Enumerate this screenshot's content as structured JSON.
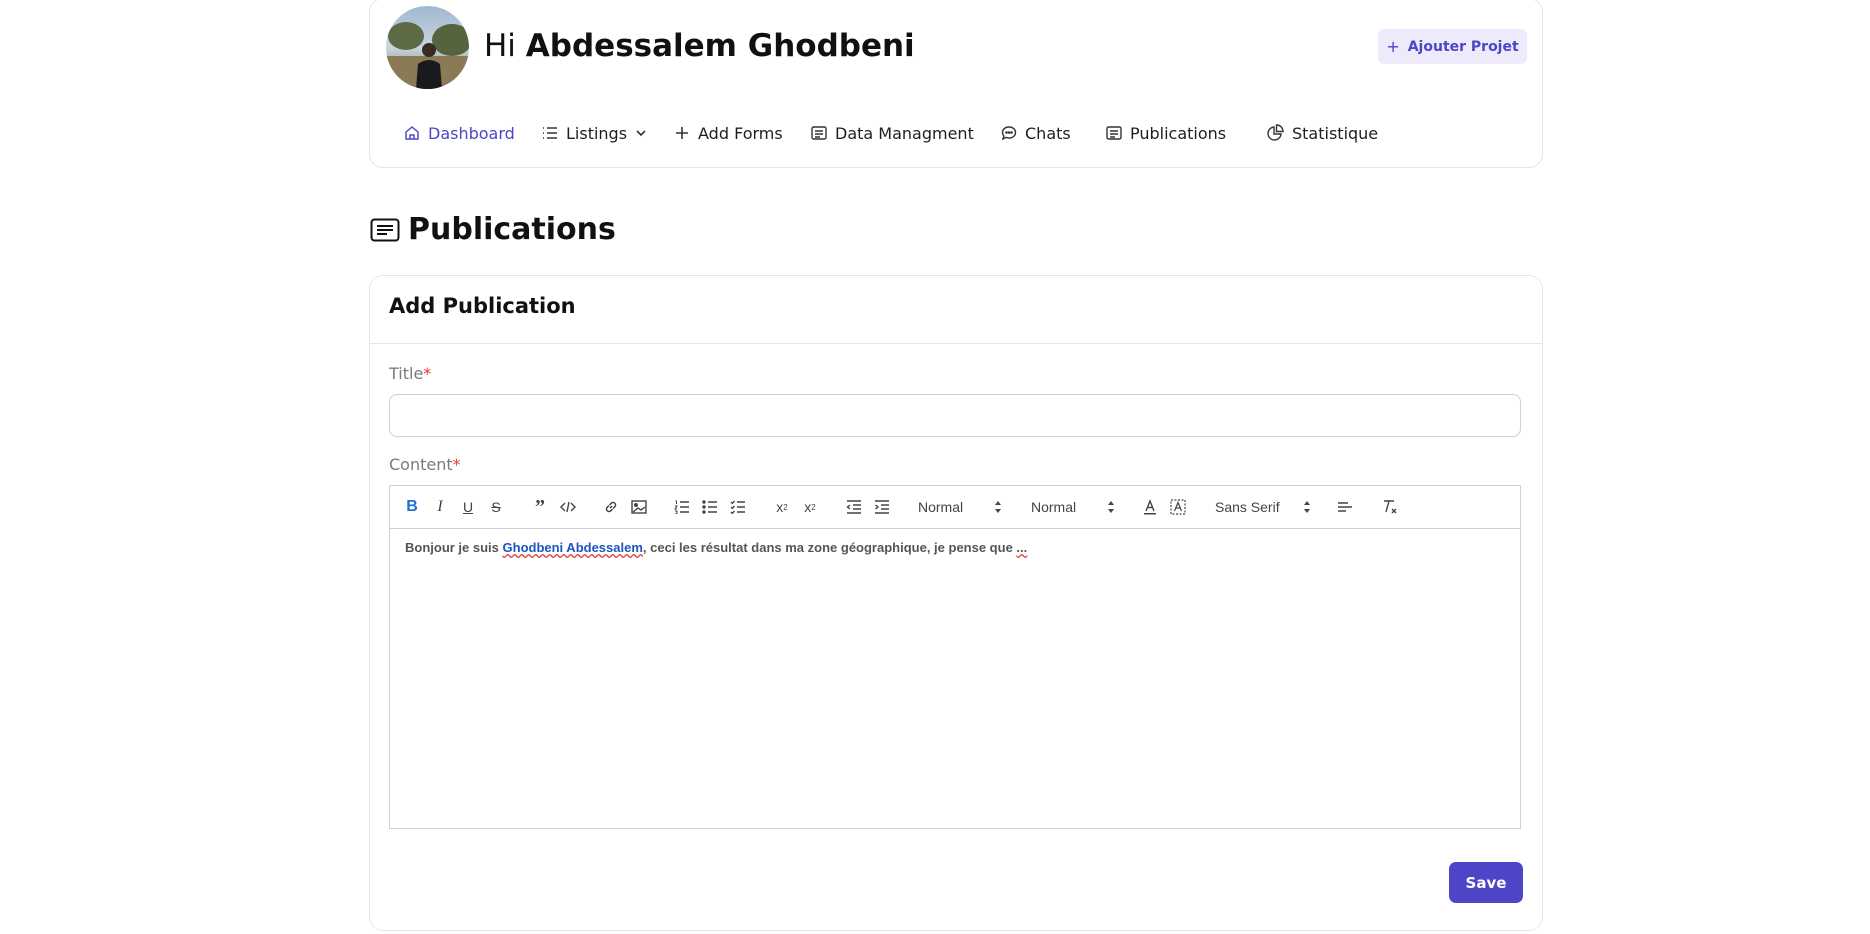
{
  "header": {
    "greeting_prefix": "Hi",
    "user_name": "Abdessalem Ghodbeni",
    "add_project_label": "Ajouter Projet"
  },
  "nav": {
    "items": [
      {
        "label": "Dashboard",
        "icon": "home-icon",
        "active": true
      },
      {
        "label": "Listings",
        "icon": "list-icon",
        "has_dropdown": true
      },
      {
        "label": "Add Forms",
        "icon": "plus-icon"
      },
      {
        "label": "Data Managment",
        "icon": "document-icon"
      },
      {
        "label": "Chats",
        "icon": "chat-bubble-icon"
      },
      {
        "label": "Publications",
        "icon": "document-icon"
      },
      {
        "label": "Statistique",
        "icon": "pie-chart-icon"
      }
    ]
  },
  "page": {
    "title": "Publications",
    "title_icon": "document-icon"
  },
  "form": {
    "card_title": "Add Publication",
    "title_label": "Title",
    "title_value": "",
    "content_label": "Content",
    "required_mark": "*",
    "save_label": "Save"
  },
  "editor": {
    "toolbar": {
      "header_select": "Normal",
      "size_select": "Normal",
      "font_select": "Sans Serif",
      "buttons": [
        "bold",
        "italic",
        "underline",
        "strike",
        "blockquote",
        "code",
        "link",
        "image",
        "ordered-list",
        "bullet-list",
        "check-list",
        "subscript",
        "superscript",
        "outdent",
        "indent",
        "font-color",
        "background-color",
        "align",
        "clean"
      ]
    },
    "content": {
      "before": "Bonjour je suis ",
      "link_text": "Ghodbeni Abdessalem",
      "after": ", ceci les résultat dans ma zone géographique, je pense que ",
      "trailing": "..."
    }
  },
  "colors": {
    "accent": "#4c45c7",
    "accent_light": "#eceafb",
    "required": "#e03b3b",
    "link": "#1b55c4",
    "border": "#e4e4ea"
  }
}
